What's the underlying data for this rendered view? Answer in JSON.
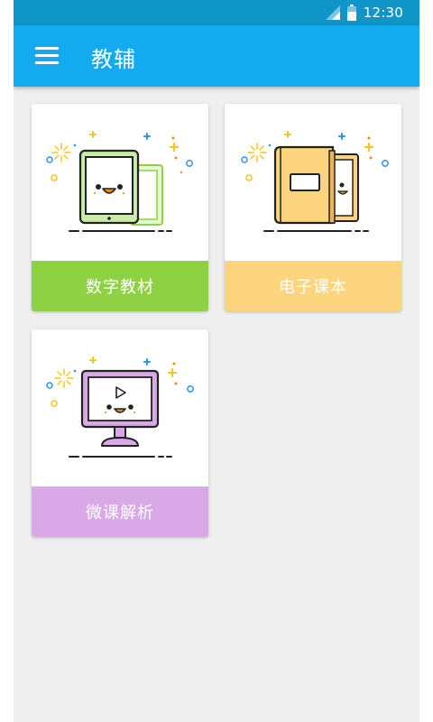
{
  "status_bar": {
    "time": "12:30",
    "icons": [
      "signal-icon",
      "battery-icon"
    ]
  },
  "app_bar": {
    "title": "教辅",
    "menu_icon": "menu-icon",
    "color": "#14aaf0"
  },
  "cards": [
    {
      "label": "数字教材",
      "icon": "tablet-icon",
      "color": "#8ed143"
    },
    {
      "label": "电子课本",
      "icon": "book-icon",
      "color": "#fdd57e"
    },
    {
      "label": "微课解析",
      "icon": "monitor-play-icon",
      "color": "#d8a9e6"
    }
  ]
}
